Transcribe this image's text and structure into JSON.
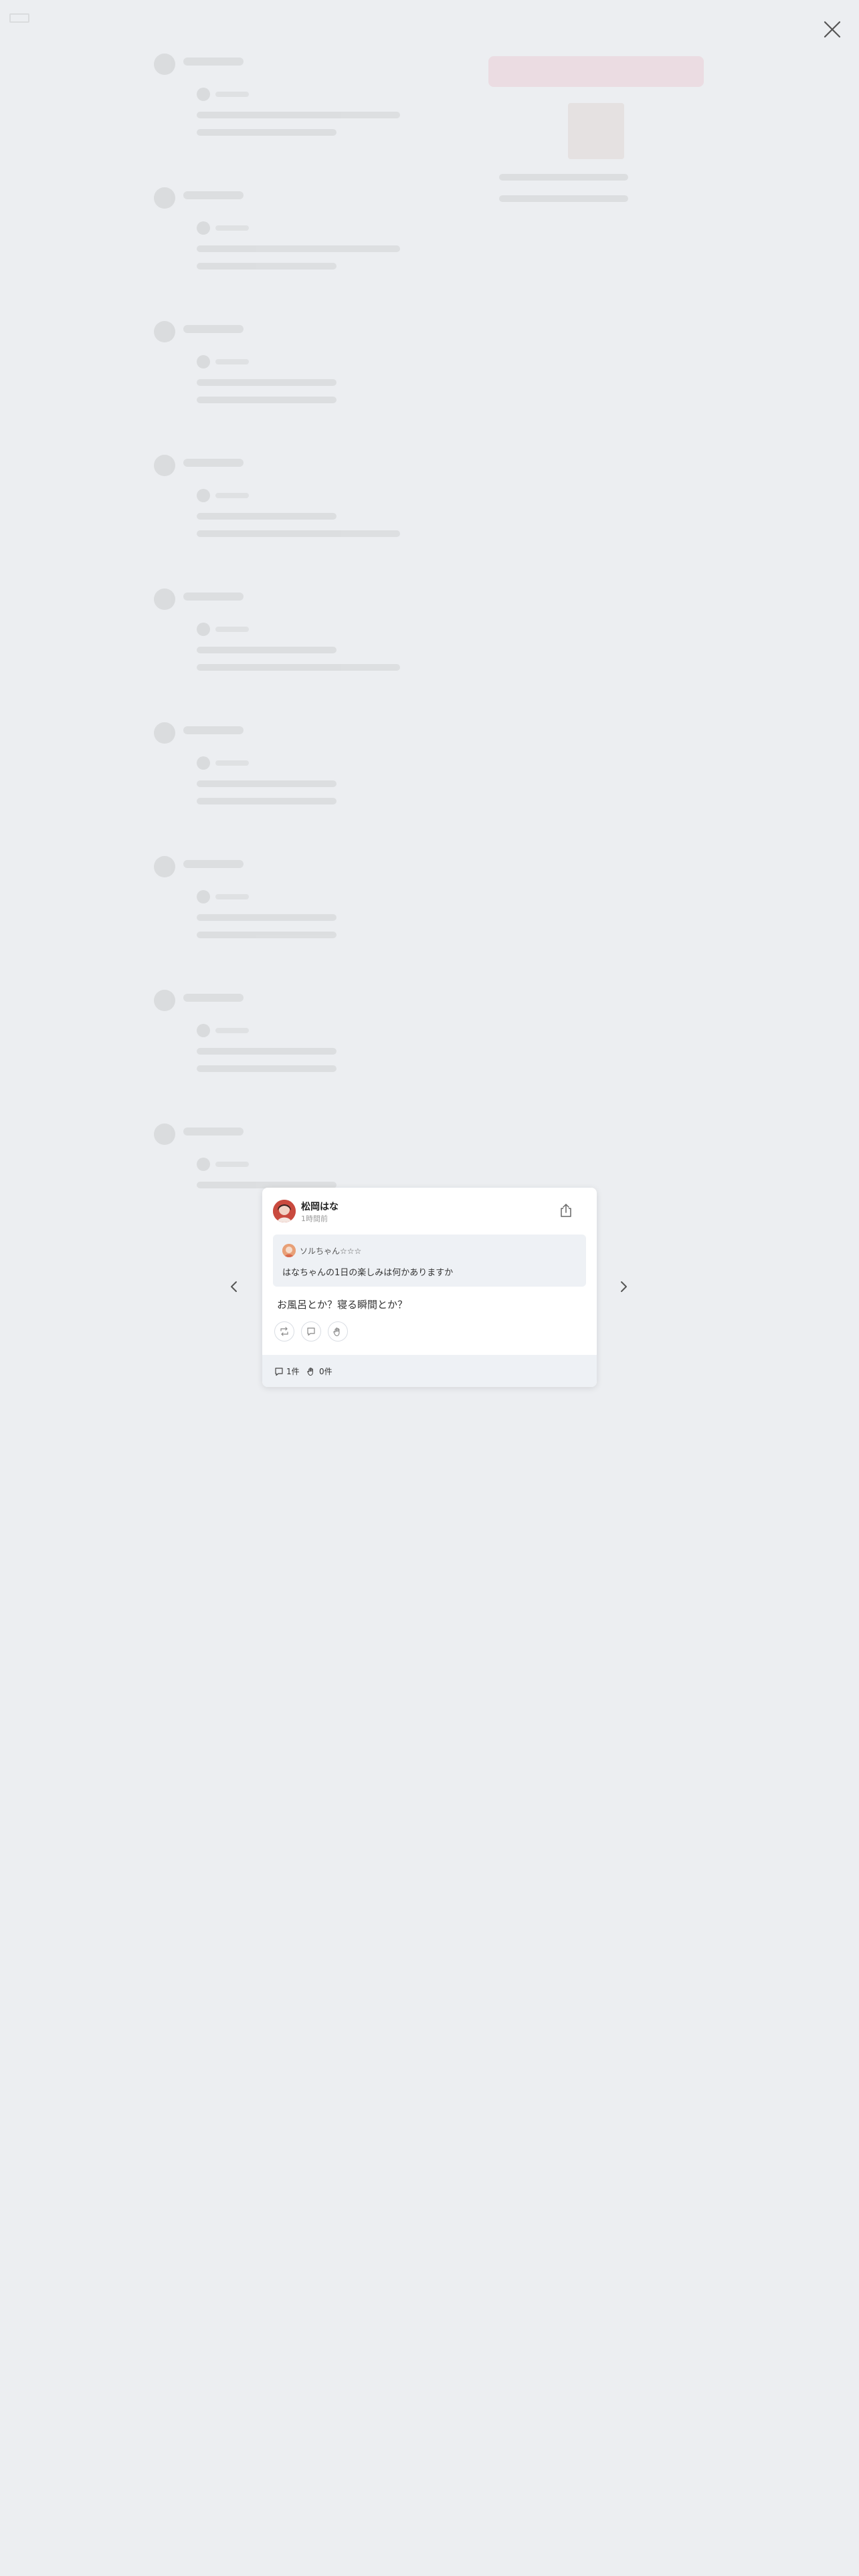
{
  "question": {
    "author_name": "ソルちゃん☆☆☆",
    "text": "はなちゃんの1日の楽しみは何かありますか"
  },
  "answer": {
    "author_name": "松岡はな",
    "time": "1時間前",
    "text": "お風呂とか？寝る瞬間とか？"
  },
  "stats": {
    "comments": "1件",
    "claps": "0件"
  },
  "icons": {
    "share": "share-icon",
    "repost": "repost-icon",
    "comment": "comment-icon",
    "clap": "clap-icon",
    "prev": "chevron-left-icon",
    "next": "chevron-right-icon",
    "close": "close-icon"
  },
  "colors": {
    "background": "#eceef1",
    "card": "#ffffff",
    "quote_bg": "#eef1f5",
    "footer_bg": "#eef1f5"
  }
}
